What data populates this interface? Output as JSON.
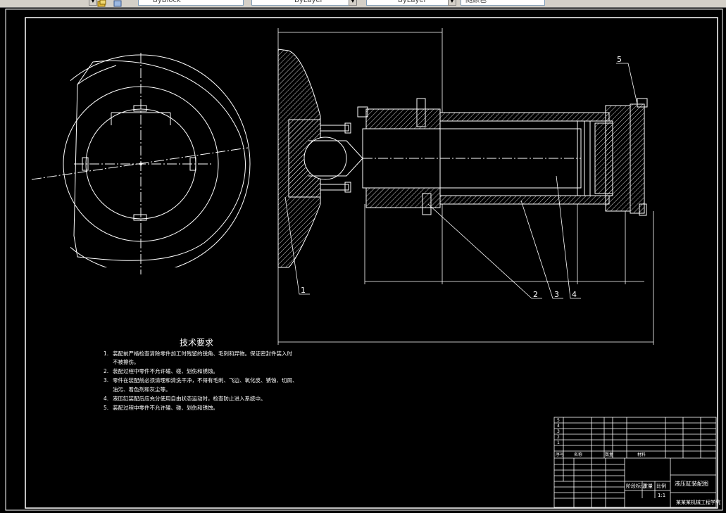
{
  "toolbar": {
    "block_combo": "ByBlock",
    "layer_combo": "ByLayer",
    "linetype_combo": "ByLayer",
    "color_combo": "随颜色"
  },
  "drawing": {
    "callouts": [
      "1",
      "2",
      "3",
      "4",
      "5"
    ],
    "tech_title": "技术要求",
    "tech_notes": [
      {
        "num": "1.",
        "text": "装配前严格检查清除零件加工时残留的锐角、毛刺和异物。保证密封件装入时"
      },
      {
        "num": "",
        "text": "不被擦伤。"
      },
      {
        "num": "2.",
        "text": "装配过程中零件不允许磕、碰、划伤和锈蚀。"
      },
      {
        "num": "3.",
        "text": "零件在装配前必须清理和清洗干净，不得有毛刺、飞边、氧化皮、锈蚀、切屑、"
      },
      {
        "num": "",
        "text": "油污、着色剂和灰尘等。"
      },
      {
        "num": "4.",
        "text": "液压缸装配后应充分使用自由状态运动时，检查防止进入系统中。"
      },
      {
        "num": "5.",
        "text": "装配过程中零件不允许磕、碰、划伤和锈蚀。"
      }
    ],
    "bom_numbers": [
      "5",
      "4",
      "3",
      "2",
      "1"
    ],
    "bom_header": {
      "no": "序号",
      "name": "名称",
      "qty": "数量",
      "mat": "材料"
    },
    "title_block": {
      "drawing_name": "液压缸装配图",
      "stage_label": "阶段标记",
      "weight_label": "重量",
      "scale_label": "比例",
      "scale_value": "1:1",
      "company": "某某某机械工程学院"
    }
  }
}
